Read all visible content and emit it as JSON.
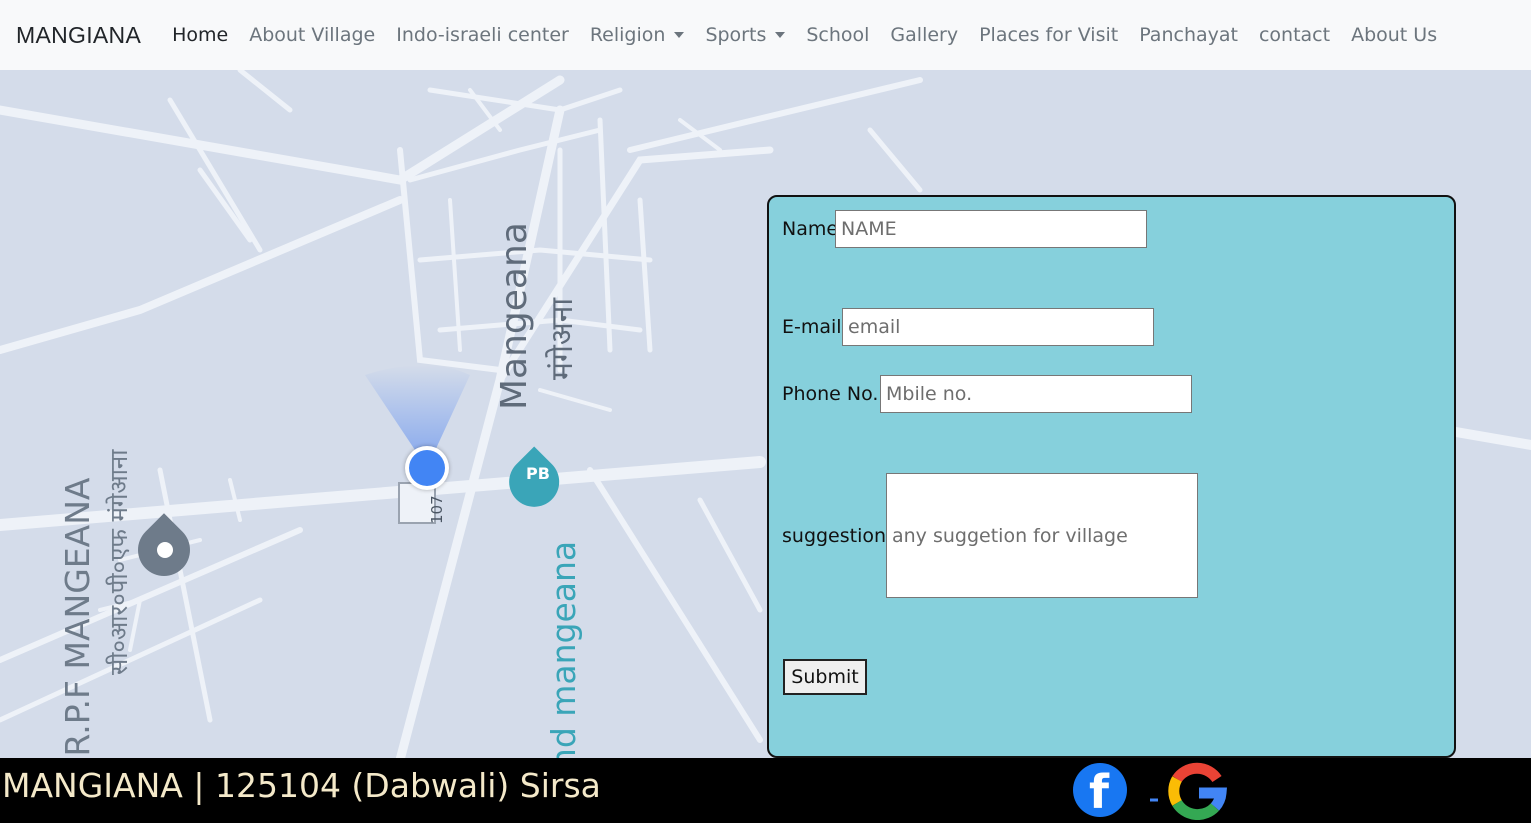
{
  "navbar": {
    "brand": "MANGIANA",
    "items": [
      {
        "label": "Home",
        "active": true
      },
      {
        "label": "About Village"
      },
      {
        "label": "Indo-israeli center"
      },
      {
        "label": "Religion",
        "dropdown": true
      },
      {
        "label": "Sports",
        "dropdown": true
      },
      {
        "label": "School"
      },
      {
        "label": "Gallery"
      },
      {
        "label": "Places for Visit"
      },
      {
        "label": "Panchayat"
      },
      {
        "label": "contact"
      },
      {
        "label": "About Us"
      }
    ]
  },
  "map": {
    "labels": {
      "village_en": "Mangeana",
      "village_hi": "मंगेअना",
      "place_en": "C.R.P.F MANGEANA",
      "place_hi": "सी०आर०पी०एफ मंगेआना",
      "pump": "und mangeana",
      "road": "107",
      "pb_icon": "PB"
    },
    "icons": [
      "my-location-icon",
      "pb-pin-icon",
      "place-pin-icon"
    ]
  },
  "form": {
    "name_label": "Name",
    "name_placeholder": "NAME",
    "email_label": "E-mail",
    "email_placeholder": "email",
    "phone_label": "Phone No.",
    "phone_placeholder": "Mbile no.",
    "suggestion_label": "suggestion",
    "suggestion_placeholder": "any suggetion for village",
    "submit_label": "Submit"
  },
  "footer": {
    "text": "MANGIANA | 125104 (Dabwali) Sirsa",
    "social": [
      "facebook-icon",
      "google-icon"
    ]
  },
  "colors": {
    "form_bg": "#86d0dc",
    "map_bg": "#d4dcea",
    "footer_bg": "#000000",
    "footer_text": "#f4e9c9"
  }
}
